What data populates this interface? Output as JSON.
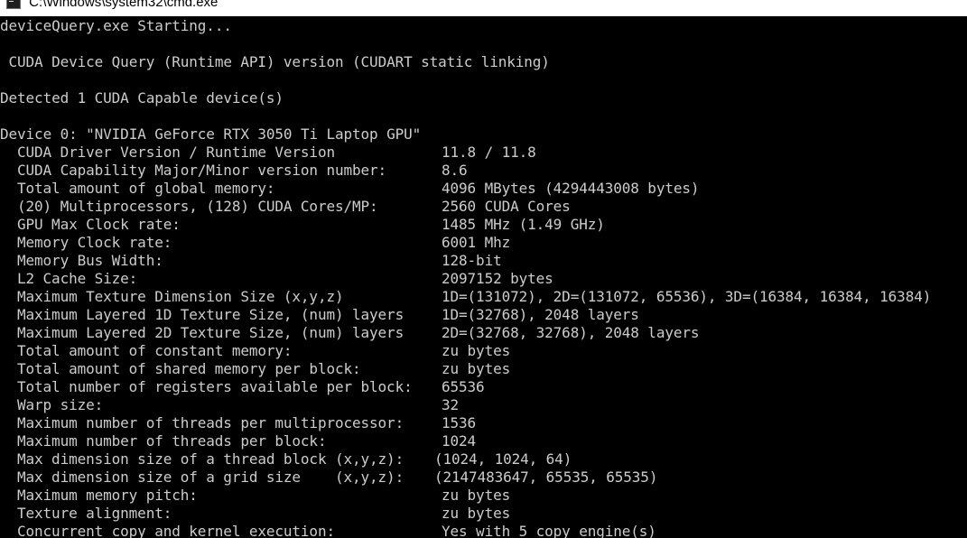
{
  "window": {
    "title": "C:\\Windows\\system32\\cmd.exe",
    "icon": "console-window-icon",
    "background": "#000000",
    "foreground": "#cccccc"
  },
  "console": {
    "starting": "deviceQuery.exe Starting...",
    "header": " CUDA Device Query (Runtime API) version (CUDART static linking)",
    "detected": "Detected 1 CUDA Capable device(s)",
    "device": "Device 0: \"NVIDIA GeForce RTX 3050 Ti Laptop GPU\"",
    "properties": [
      {
        "label": "CUDA Driver Version / Runtime Version",
        "value": "11.8 / 11.8"
      },
      {
        "label": "CUDA Capability Major/Minor version number:",
        "value": "8.6"
      },
      {
        "label": "Total amount of global memory:",
        "value": "4096 MBytes (4294443008 bytes)"
      },
      {
        "label": "(20) Multiprocessors, (128) CUDA Cores/MP:",
        "value": "2560 CUDA Cores"
      },
      {
        "label": "GPU Max Clock rate:",
        "value": "1485 MHz (1.49 GHz)"
      },
      {
        "label": "Memory Clock rate:",
        "value": "6001 Mhz"
      },
      {
        "label": "Memory Bus Width:",
        "value": "128-bit"
      },
      {
        "label": "L2 Cache Size:",
        "value": "2097152 bytes"
      },
      {
        "label": "Maximum Texture Dimension Size (x,y,z)",
        "value": "1D=(131072), 2D=(131072, 65536), 3D=(16384, 16384, 16384)"
      },
      {
        "label": "Maximum Layered 1D Texture Size, (num) layers",
        "value": "1D=(32768), 2048 layers"
      },
      {
        "label": "Maximum Layered 2D Texture Size, (num) layers",
        "value": "2D=(32768, 32768), 2048 layers"
      },
      {
        "label": "Total amount of constant memory:",
        "value": "zu bytes"
      },
      {
        "label": "Total amount of shared memory per block:",
        "value": "zu bytes"
      },
      {
        "label": "Total number of registers available per block:",
        "value": "65536"
      },
      {
        "label": "Warp size:",
        "value": "32"
      },
      {
        "label": "Maximum number of threads per multiprocessor:",
        "value": "1536"
      },
      {
        "label": "Maximum number of threads per block:",
        "value": "1024"
      },
      {
        "label": "Max dimension size of a thread block (x,y,z):",
        "value": "(1024, 1024, 64)"
      },
      {
        "label": "Max dimension size of a grid size    (x,y,z):",
        "value": "(2147483647, 65535, 65535)"
      },
      {
        "label": "Maximum memory pitch:",
        "value": "zu bytes"
      },
      {
        "label": "Texture alignment:",
        "value": "zu bytes"
      },
      {
        "label": "Concurrent copy and kernel execution:",
        "value": "Yes with 5 copy engine(s)"
      }
    ]
  }
}
